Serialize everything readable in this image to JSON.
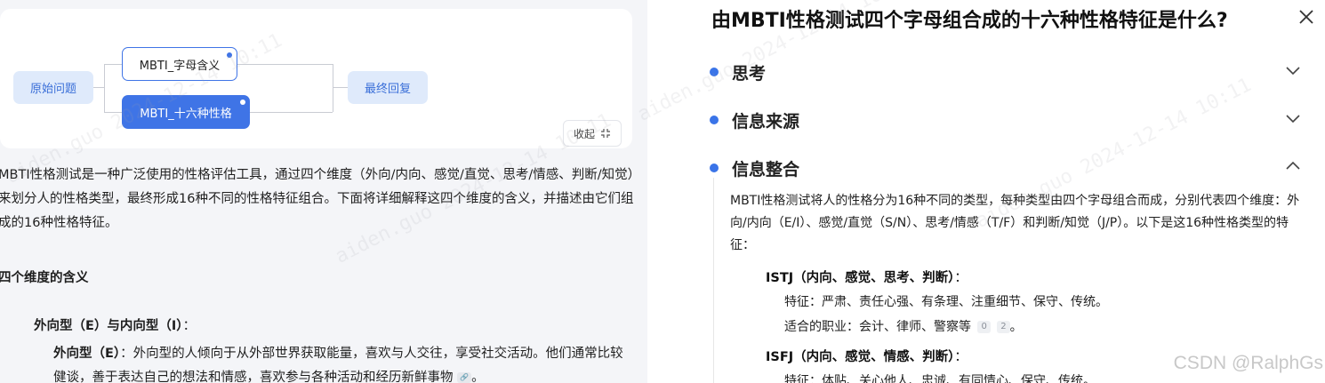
{
  "flow": {
    "start": "原始问题",
    "node_a": "MBTI_字母含义",
    "node_b": "MBTI_十六种性格",
    "end": "最终回复",
    "collapse_label": "收起"
  },
  "left": {
    "intro": "MBTI性格测试是一种广泛使用的性格评估工具，通过四个维度（外向/内向、感觉/直觉、思考/情感、判断/知觉）来划分人的性格类型，最终形成16种不同的性格特征组合。下面将详细解释这四个维度的含义，并描述由它们组成的16种性格特征。",
    "heading": "四个维度的含义",
    "ei_heading": "外向型（E）与内向型（I）",
    "ei_colon": "：",
    "e_term": "外向型（E）",
    "e_text": "：外向型的人倾向于从外部世界获取能量，喜欢与人交往，享受社交活动。他们通常比较健谈，善于表达自己的想法和情感，喜欢参与各种活动和经历新鲜事物",
    "e_tail": "。"
  },
  "right": {
    "title": "由MBTI性格测试四个字母组合成的十六种性格特征是什么?",
    "sections": [
      {
        "label": "思考",
        "chev": "down"
      },
      {
        "label": "信息来源",
        "chev": "down"
      },
      {
        "label": "信息整合",
        "chev": "up"
      }
    ],
    "body": "MBTI性格测试将人的性格分为16种不同的类型，每种类型由四个字母组合而成，分别代表四个维度：外向/内向（E/I）、感觉/直觉（S/N）、思考/情感（T/F）和判断/知觉（J/P）。以下是这16种性格类型的特征：",
    "types": [
      {
        "title": "ISTJ（内向、感觉、思考、判断）",
        "colon": "：",
        "trait": "特征：严肃、责任心强、有条理、注重细节、保守、传统。",
        "job": "适合的职业：会计、律师、警察等",
        "refs": [
          "0",
          "2"
        ],
        "job_tail": "。"
      },
      {
        "title": "ISFJ（内向、感觉、情感、判断）",
        "colon": "：",
        "trait": "特征：体贴、关心他人、忠诚、有同情心、保守、传统。"
      }
    ]
  },
  "watermark": "aiden.guo 2024-12-14 10:11",
  "footer": "CSDN @RalphGs"
}
